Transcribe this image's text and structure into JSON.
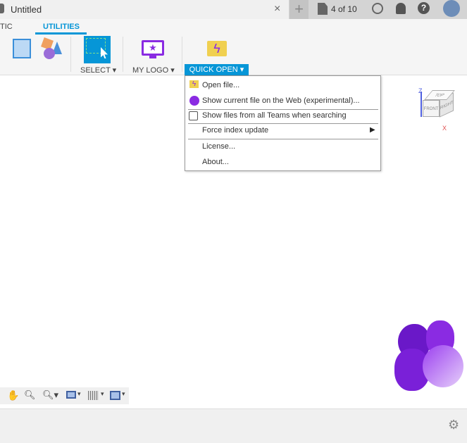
{
  "title": {
    "doc_name": "Untitled",
    "close": "×",
    "new_tab": "+",
    "job_status": "4 of 10"
  },
  "tabs": [
    {
      "label": "TIC"
    },
    {
      "label": "UTILITIES",
      "active": true
    }
  ],
  "toolbar": {
    "select_label": "SELECT",
    "my_logo_label": "MY LOGO",
    "quick_open_label": "QUICK OPEN"
  },
  "menu": {
    "items": [
      {
        "label": "Open file...",
        "icon": "lightning-folder-icon"
      },
      {
        "label": "Show current file on the Web (experimental)...",
        "icon": "globe-icon"
      },
      {
        "label": "Show files from all Teams when searching",
        "checkbox": false
      },
      {
        "label": "Force index update",
        "submenu": true
      },
      {
        "label": "License..."
      },
      {
        "label": "About..."
      }
    ]
  },
  "viewcube": {
    "top": "TOP",
    "front": "FRONT",
    "right": "RIGHT",
    "z": "Z",
    "x": "X"
  },
  "colors": {
    "accent": "#0696d7",
    "logo_purple": "#8a2be2"
  }
}
